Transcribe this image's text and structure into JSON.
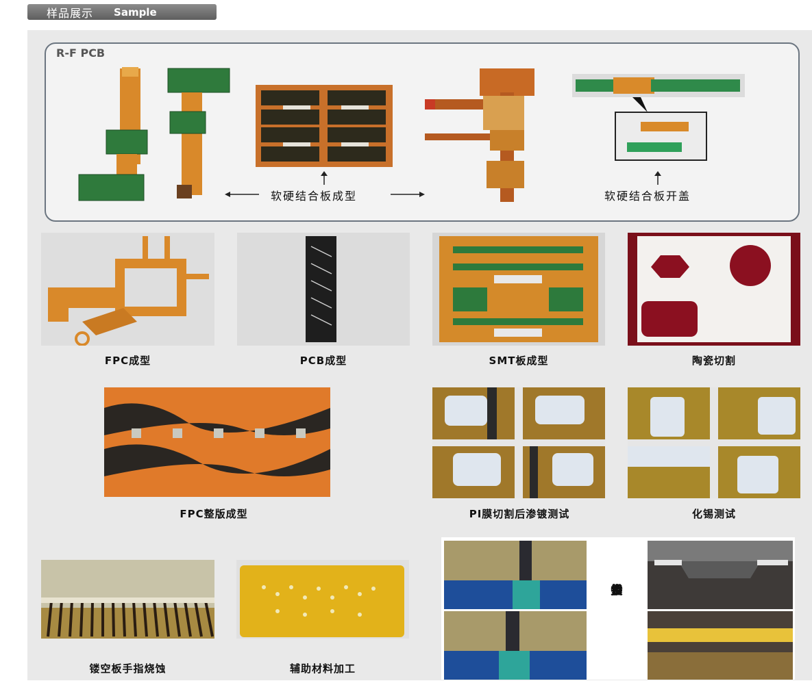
{
  "header": {
    "title_cn": "样品展示",
    "title_en": "Sample"
  },
  "rf_section": {
    "title": "R-F PCB",
    "caption_left": "软硬结合板成型",
    "caption_right": "软硬结合板开盖"
  },
  "row1": [
    "FPC成型",
    "PCB成型",
    "SMT板成型",
    "陶瓷切割"
  ],
  "row2": [
    "FPC整版成型",
    "PI膜切割后渗镀测试",
    "化锡测试"
  ],
  "row3": [
    "镂空板手指烧蚀",
    "辅助材料加工"
  ],
  "gold_finger_label": [
    "金",
    "手",
    "指",
    "修",
    "复"
  ],
  "colors": {
    "panel_bg": "#e9e9e9",
    "fpc_orange": "#d9892a",
    "pcb_green": "#2f7a3c",
    "ceramic_red": "#8b1020"
  }
}
